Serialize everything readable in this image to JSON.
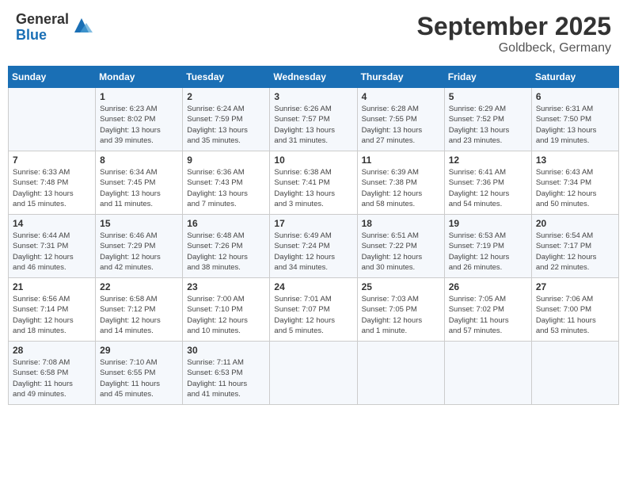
{
  "header": {
    "logo_general": "General",
    "logo_blue": "Blue",
    "month": "September 2025",
    "location": "Goldbeck, Germany"
  },
  "weekdays": [
    "Sunday",
    "Monday",
    "Tuesday",
    "Wednesday",
    "Thursday",
    "Friday",
    "Saturday"
  ],
  "weeks": [
    [
      {
        "day": "",
        "info": ""
      },
      {
        "day": "1",
        "info": "Sunrise: 6:23 AM\nSunset: 8:02 PM\nDaylight: 13 hours\nand 39 minutes."
      },
      {
        "day": "2",
        "info": "Sunrise: 6:24 AM\nSunset: 7:59 PM\nDaylight: 13 hours\nand 35 minutes."
      },
      {
        "day": "3",
        "info": "Sunrise: 6:26 AM\nSunset: 7:57 PM\nDaylight: 13 hours\nand 31 minutes."
      },
      {
        "day": "4",
        "info": "Sunrise: 6:28 AM\nSunset: 7:55 PM\nDaylight: 13 hours\nand 27 minutes."
      },
      {
        "day": "5",
        "info": "Sunrise: 6:29 AM\nSunset: 7:52 PM\nDaylight: 13 hours\nand 23 minutes."
      },
      {
        "day": "6",
        "info": "Sunrise: 6:31 AM\nSunset: 7:50 PM\nDaylight: 13 hours\nand 19 minutes."
      }
    ],
    [
      {
        "day": "7",
        "info": "Sunrise: 6:33 AM\nSunset: 7:48 PM\nDaylight: 13 hours\nand 15 minutes."
      },
      {
        "day": "8",
        "info": "Sunrise: 6:34 AM\nSunset: 7:45 PM\nDaylight: 13 hours\nand 11 minutes."
      },
      {
        "day": "9",
        "info": "Sunrise: 6:36 AM\nSunset: 7:43 PM\nDaylight: 13 hours\nand 7 minutes."
      },
      {
        "day": "10",
        "info": "Sunrise: 6:38 AM\nSunset: 7:41 PM\nDaylight: 13 hours\nand 3 minutes."
      },
      {
        "day": "11",
        "info": "Sunrise: 6:39 AM\nSunset: 7:38 PM\nDaylight: 12 hours\nand 58 minutes."
      },
      {
        "day": "12",
        "info": "Sunrise: 6:41 AM\nSunset: 7:36 PM\nDaylight: 12 hours\nand 54 minutes."
      },
      {
        "day": "13",
        "info": "Sunrise: 6:43 AM\nSunset: 7:34 PM\nDaylight: 12 hours\nand 50 minutes."
      }
    ],
    [
      {
        "day": "14",
        "info": "Sunrise: 6:44 AM\nSunset: 7:31 PM\nDaylight: 12 hours\nand 46 minutes."
      },
      {
        "day": "15",
        "info": "Sunrise: 6:46 AM\nSunset: 7:29 PM\nDaylight: 12 hours\nand 42 minutes."
      },
      {
        "day": "16",
        "info": "Sunrise: 6:48 AM\nSunset: 7:26 PM\nDaylight: 12 hours\nand 38 minutes."
      },
      {
        "day": "17",
        "info": "Sunrise: 6:49 AM\nSunset: 7:24 PM\nDaylight: 12 hours\nand 34 minutes."
      },
      {
        "day": "18",
        "info": "Sunrise: 6:51 AM\nSunset: 7:22 PM\nDaylight: 12 hours\nand 30 minutes."
      },
      {
        "day": "19",
        "info": "Sunrise: 6:53 AM\nSunset: 7:19 PM\nDaylight: 12 hours\nand 26 minutes."
      },
      {
        "day": "20",
        "info": "Sunrise: 6:54 AM\nSunset: 7:17 PM\nDaylight: 12 hours\nand 22 minutes."
      }
    ],
    [
      {
        "day": "21",
        "info": "Sunrise: 6:56 AM\nSunset: 7:14 PM\nDaylight: 12 hours\nand 18 minutes."
      },
      {
        "day": "22",
        "info": "Sunrise: 6:58 AM\nSunset: 7:12 PM\nDaylight: 12 hours\nand 14 minutes."
      },
      {
        "day": "23",
        "info": "Sunrise: 7:00 AM\nSunset: 7:10 PM\nDaylight: 12 hours\nand 10 minutes."
      },
      {
        "day": "24",
        "info": "Sunrise: 7:01 AM\nSunset: 7:07 PM\nDaylight: 12 hours\nand 5 minutes."
      },
      {
        "day": "25",
        "info": "Sunrise: 7:03 AM\nSunset: 7:05 PM\nDaylight: 12 hours\nand 1 minute."
      },
      {
        "day": "26",
        "info": "Sunrise: 7:05 AM\nSunset: 7:02 PM\nDaylight: 11 hours\nand 57 minutes."
      },
      {
        "day": "27",
        "info": "Sunrise: 7:06 AM\nSunset: 7:00 PM\nDaylight: 11 hours\nand 53 minutes."
      }
    ],
    [
      {
        "day": "28",
        "info": "Sunrise: 7:08 AM\nSunset: 6:58 PM\nDaylight: 11 hours\nand 49 minutes."
      },
      {
        "day": "29",
        "info": "Sunrise: 7:10 AM\nSunset: 6:55 PM\nDaylight: 11 hours\nand 45 minutes."
      },
      {
        "day": "30",
        "info": "Sunrise: 7:11 AM\nSunset: 6:53 PM\nDaylight: 11 hours\nand 41 minutes."
      },
      {
        "day": "",
        "info": ""
      },
      {
        "day": "",
        "info": ""
      },
      {
        "day": "",
        "info": ""
      },
      {
        "day": "",
        "info": ""
      }
    ]
  ]
}
